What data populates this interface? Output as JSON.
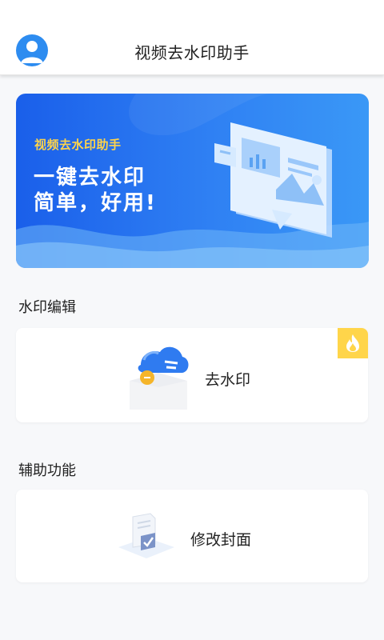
{
  "header": {
    "title": "视频去水印助手",
    "avatar_icon": "user-avatar-icon"
  },
  "banner": {
    "subtitle": "视频去水印助手",
    "line1": "一键去水印",
    "line2": "简单，好用!",
    "subtitle_color": "#ffd44a",
    "background_color": "#2f80f3"
  },
  "sections": {
    "watermark_edit": {
      "title": "水印编辑",
      "card_label": "去水印",
      "card_icon": "cloud-watermark-icon",
      "badge_icon": "flame-icon",
      "badge_color": "#ffd54a"
    },
    "assist": {
      "title": "辅助功能",
      "card_label": "修改封面",
      "card_icon": "document-cover-icon"
    }
  }
}
